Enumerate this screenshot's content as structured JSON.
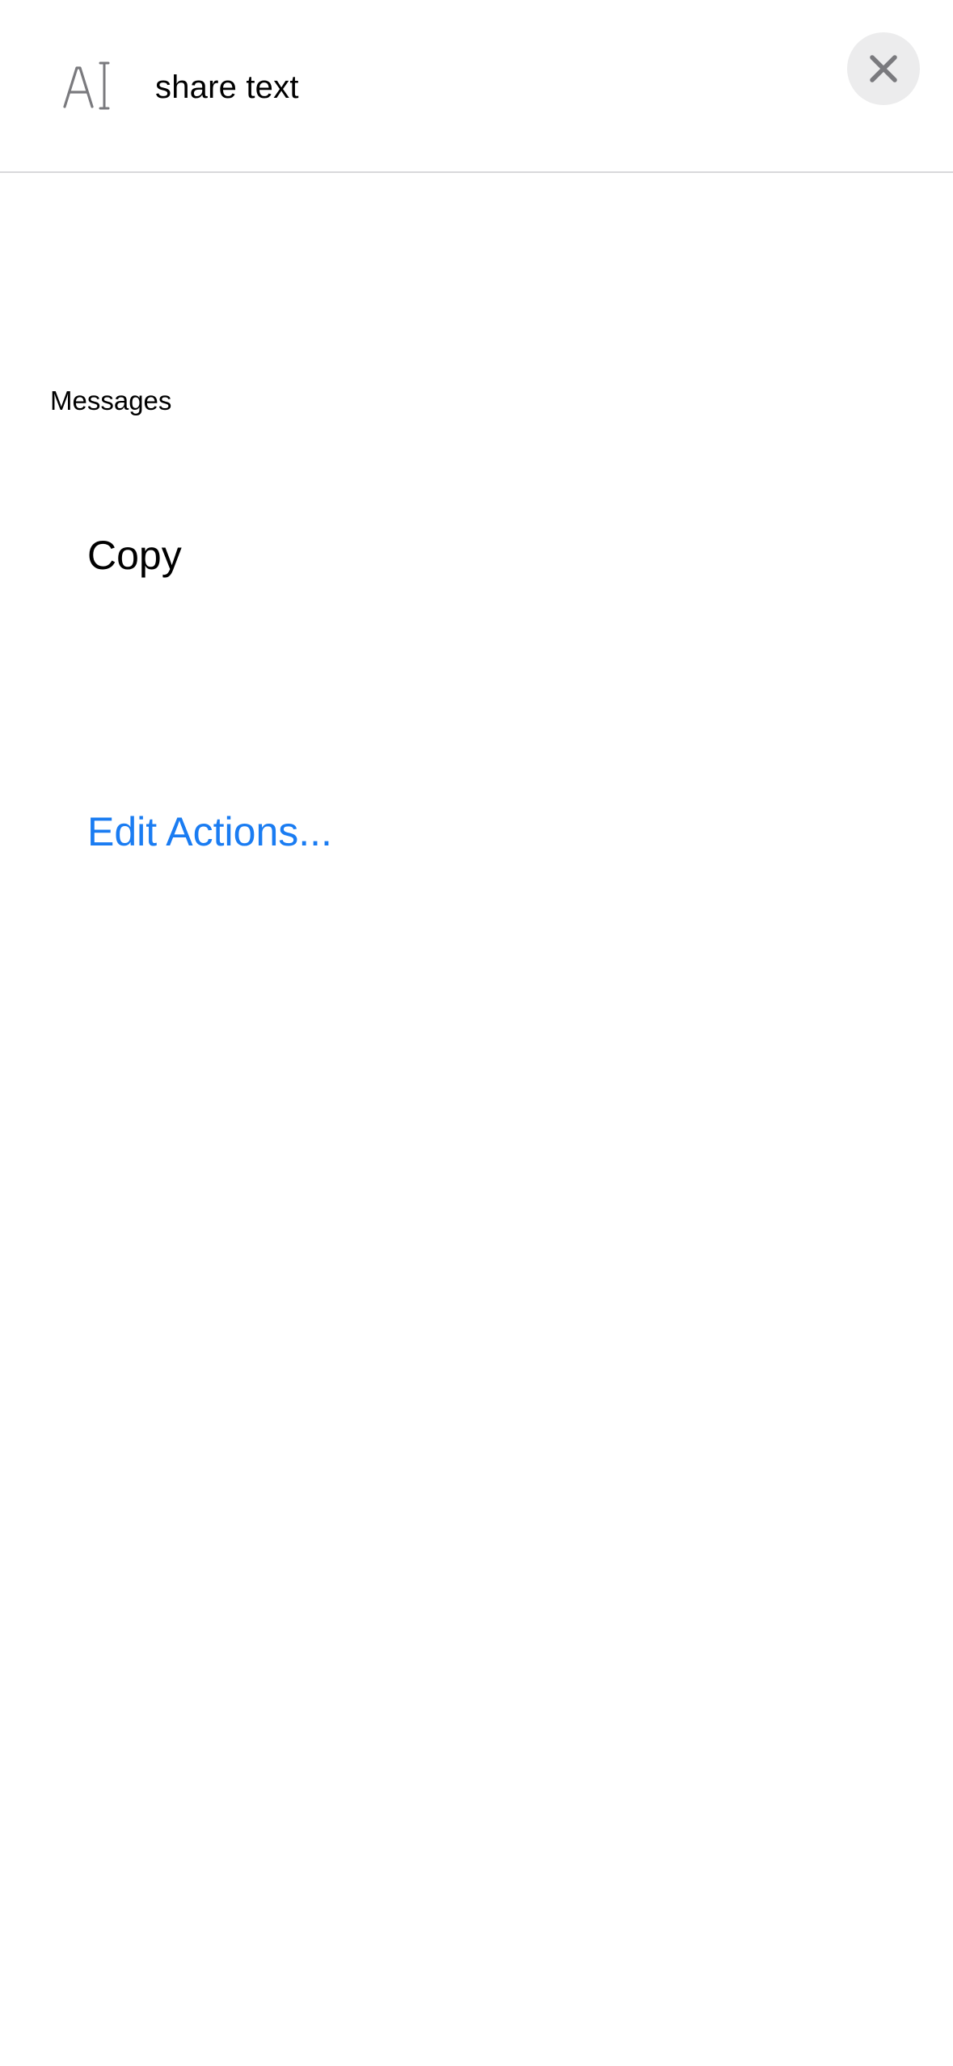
{
  "header": {
    "icon": "text-cursor-icon",
    "title": "share text",
    "close_icon": "close-icon"
  },
  "section": {
    "title": "Messages"
  },
  "actions": {
    "copy_label": "Copy",
    "edit_label": "Edit Actions..."
  },
  "colors": {
    "accent": "#1a7cf2",
    "close_button_bg": "#ececed",
    "icon_gray": "#7a7a7e",
    "divider": "#d9d9db"
  }
}
